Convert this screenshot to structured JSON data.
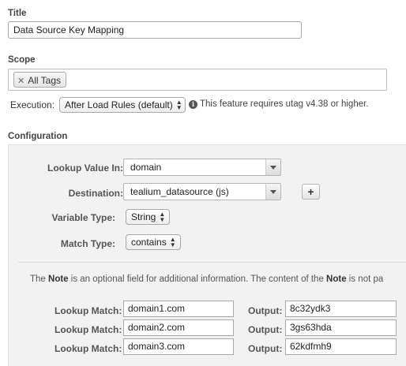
{
  "title_section": {
    "label": "Title",
    "value": "Data Source Key Mapping"
  },
  "scope_section": {
    "label": "Scope",
    "tags": [
      {
        "label": "All Tags"
      }
    ]
  },
  "execution": {
    "label": "Execution:",
    "selected": "After Load Rules (default)",
    "note": "This feature requires utag v4.38 or higher."
  },
  "configuration": {
    "label": "Configuration",
    "lookup_value_in": {
      "label": "Lookup Value In:",
      "value": "domain"
    },
    "destination": {
      "label": "Destination:",
      "value": "tealium_datasource (js)",
      "add_label": "+"
    },
    "variable_type": {
      "label": "Variable Type:",
      "value": "String"
    },
    "match_type": {
      "label": "Match Type:",
      "value": "contains"
    },
    "note": {
      "prefix": "The ",
      "bold1": "Note",
      "middle": " is an optional field for additional information. The content of the ",
      "bold2": "Note",
      "suffix": " is not pa"
    },
    "rows": [
      {
        "match_label": "Lookup Match:",
        "match": "domain1.com",
        "output_label": "Output:",
        "output": "8c32ydk3"
      },
      {
        "match_label": "Lookup Match:",
        "match": "domain2.com",
        "output_label": "Output:",
        "output": "3gs63hda"
      },
      {
        "match_label": "Lookup Match:",
        "match": "domain3.com",
        "output_label": "Output:",
        "output": "62kdfmh9"
      }
    ]
  },
  "icons": {
    "info": "info-icon",
    "remove_tag": "close-icon",
    "dropdown": "chevron-down-icon",
    "select_arrows": "up-down-arrows-icon"
  }
}
